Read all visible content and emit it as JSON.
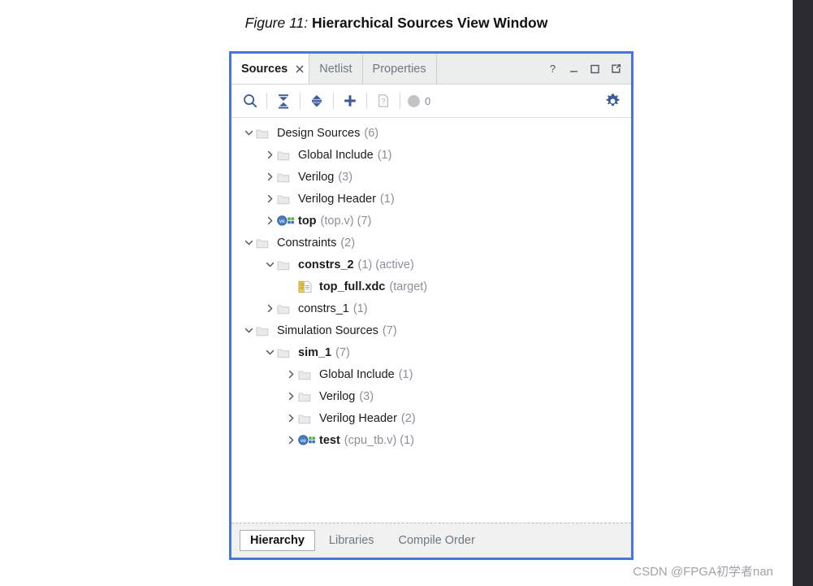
{
  "figure": {
    "label": "Figure 11:",
    "title": "Hierarchical Sources View Window"
  },
  "panel": {
    "accent_color": "#4a77d4",
    "tabs": [
      {
        "label": "Sources",
        "active": true,
        "closable": true
      },
      {
        "label": "Netlist",
        "active": false,
        "closable": false
      },
      {
        "label": "Properties",
        "active": false,
        "closable": false
      }
    ],
    "window_controls": [
      {
        "name": "help-button",
        "glyph": "?"
      },
      {
        "name": "minimize-button",
        "glyph": "—"
      },
      {
        "name": "maximize-button",
        "glyph": "□"
      },
      {
        "name": "float-button",
        "glyph": "↗"
      }
    ],
    "toolbar": {
      "search_tooltip": "Search",
      "collapse_all_tooltip": "Collapse All",
      "expand_all_tooltip": "Expand All",
      "add_sources_tooltip": "Add Sources",
      "report_tooltip": "Report",
      "settings_tooltip": "Settings",
      "message_count": "0"
    },
    "bottom_tabs": [
      {
        "label": "Hierarchy",
        "active": true
      },
      {
        "label": "Libraries",
        "active": false
      },
      {
        "label": "Compile Order",
        "active": false
      }
    ]
  },
  "tree": {
    "nodes": [
      {
        "indent": 0,
        "twisty": "expanded",
        "icon": "folder",
        "label": "Design Sources",
        "bold": false,
        "meta": "(6)",
        "meta2": ""
      },
      {
        "indent": 1,
        "twisty": "collapsed",
        "icon": "folder",
        "label": "Global Include",
        "bold": false,
        "meta": "(1)",
        "meta2": ""
      },
      {
        "indent": 1,
        "twisty": "collapsed",
        "icon": "folder",
        "label": "Verilog",
        "bold": false,
        "meta": "(3)",
        "meta2": ""
      },
      {
        "indent": 1,
        "twisty": "collapsed",
        "icon": "folder",
        "label": "Verilog Header",
        "bold": false,
        "meta": "(1)",
        "meta2": ""
      },
      {
        "indent": 1,
        "twisty": "collapsed",
        "icon": "verilog-module",
        "label": "top",
        "bold": true,
        "meta": "(top.v)",
        "meta2": "(7)"
      },
      {
        "indent": 0,
        "twisty": "expanded",
        "icon": "folder",
        "label": "Constraints",
        "bold": false,
        "meta": "(2)",
        "meta2": ""
      },
      {
        "indent": 1,
        "twisty": "expanded",
        "icon": "folder",
        "label": "constrs_2",
        "bold": true,
        "meta": "(1)",
        "meta2": "(active)"
      },
      {
        "indent": 2,
        "twisty": "none",
        "icon": "xdc-file",
        "label": "top_full.xdc",
        "bold": true,
        "meta": "(target)",
        "meta2": ""
      },
      {
        "indent": 1,
        "twisty": "collapsed",
        "icon": "folder",
        "label": "constrs_1",
        "bold": false,
        "meta": "(1)",
        "meta2": ""
      },
      {
        "indent": 0,
        "twisty": "expanded",
        "icon": "folder",
        "label": "Simulation Sources",
        "bold": false,
        "meta": "(7)",
        "meta2": ""
      },
      {
        "indent": 1,
        "twisty": "expanded",
        "icon": "folder",
        "label": "sim_1",
        "bold": true,
        "meta": "(7)",
        "meta2": ""
      },
      {
        "indent": 2,
        "twisty": "collapsed",
        "icon": "folder",
        "label": "Global Include",
        "bold": false,
        "meta": "(1)",
        "meta2": ""
      },
      {
        "indent": 2,
        "twisty": "collapsed",
        "icon": "folder",
        "label": "Verilog",
        "bold": false,
        "meta": "(3)",
        "meta2": ""
      },
      {
        "indent": 2,
        "twisty": "collapsed",
        "icon": "folder",
        "label": "Verilog Header",
        "bold": false,
        "meta": "(2)",
        "meta2": ""
      },
      {
        "indent": 2,
        "twisty": "collapsed",
        "icon": "verilog-module",
        "label": "test",
        "bold": true,
        "meta": "(cpu_tb.v)",
        "meta2": "(1)"
      }
    ]
  },
  "watermark": "CSDN @FPGA初学者nan"
}
